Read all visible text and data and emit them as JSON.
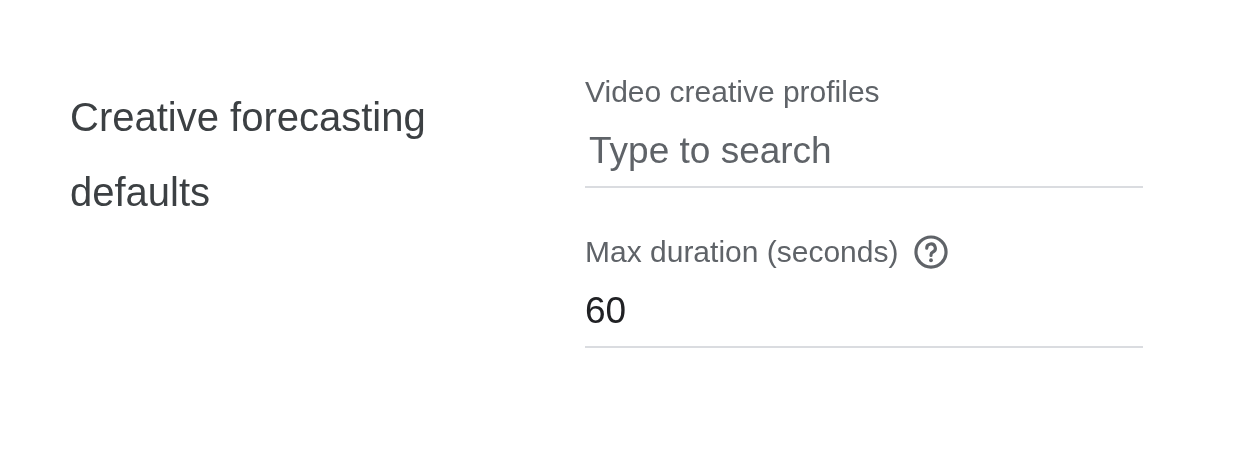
{
  "section": {
    "title": "Creative forecasting defaults"
  },
  "fields": [
    {
      "kind": "search",
      "label": "Video creative profiles",
      "placeholder": "Type to search",
      "help": false
    },
    {
      "kind": "value",
      "label": "Max duration (seconds)",
      "value": "60",
      "help": true
    }
  ]
}
